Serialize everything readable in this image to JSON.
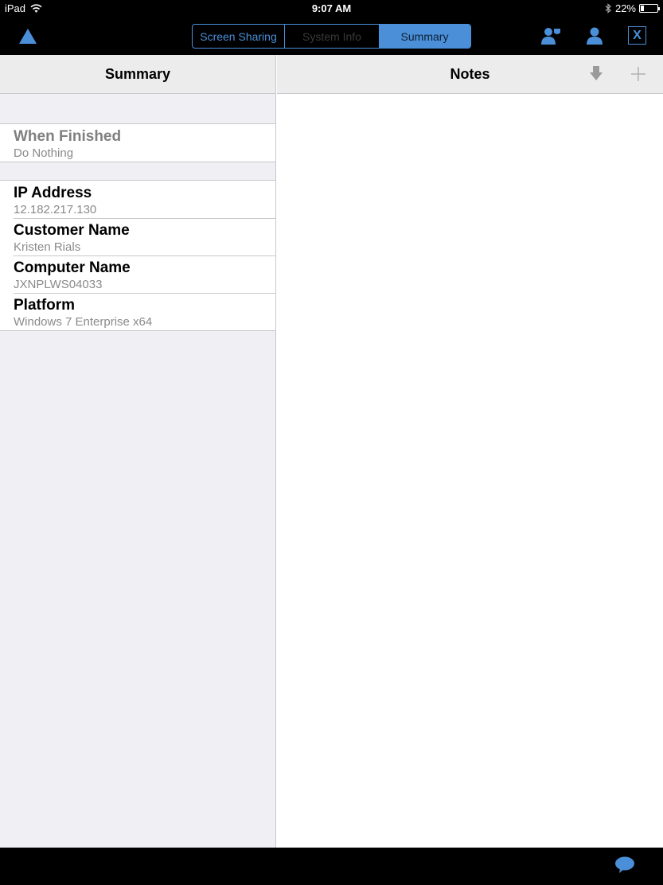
{
  "status_bar": {
    "device": "iPad",
    "time": "9:07 AM",
    "battery_percent_label": "22%",
    "battery_level": 0.22
  },
  "toolbar": {
    "logo_icon": "triangle-logo-icon",
    "segments": [
      {
        "label": "Screen Sharing",
        "state": "enabled"
      },
      {
        "label": "System Info",
        "state": "disabled"
      },
      {
        "label": "Summary",
        "state": "selected"
      }
    ],
    "close_label": "X",
    "accent_color": "#4a8fd8"
  },
  "summary_pane": {
    "title": "Summary",
    "sections": [
      {
        "rows": [
          {
            "title": "When Finished",
            "value": "Do Nothing",
            "disabled": true
          }
        ]
      },
      {
        "rows": [
          {
            "title": "IP Address",
            "value": "12.182.217.130"
          },
          {
            "title": "Customer Name",
            "value": "Kristen Rials"
          },
          {
            "title": "Computer Name",
            "value": "JXNPLWS04033"
          },
          {
            "title": "Platform",
            "value": "Windows 7 Enterprise x64"
          }
        ]
      }
    ]
  },
  "notes_pane": {
    "title": "Notes",
    "actions": [
      "download-icon",
      "add-icon"
    ]
  },
  "bottom_bar": {
    "chat_icon": "chat-bubble-icon"
  }
}
